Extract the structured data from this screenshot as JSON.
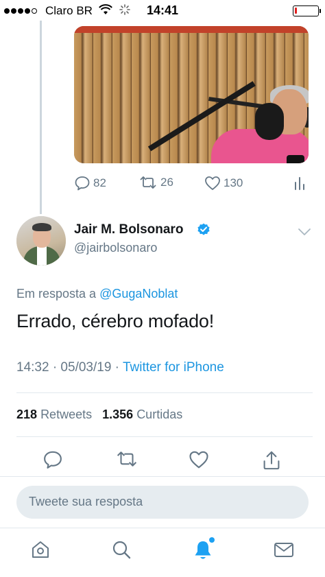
{
  "status_bar": {
    "carrier": "Claro BR",
    "time": "14:41",
    "icons": [
      "signal-dots-icon",
      "wifi-icon",
      "loading-spinner-icon",
      "battery-icon"
    ],
    "battery_color": "#e02020"
  },
  "previous_tweet": {
    "media": "video-thumbnail",
    "replies": "82",
    "retweets": "26",
    "likes": "130"
  },
  "tweet": {
    "display_name": "Jair M. Bolsonaro",
    "handle": "@jairbolsonaro",
    "verified": true,
    "reply_prefix": "Em resposta a",
    "reply_mention": "@GugaNoblat",
    "text": "Errado, cérebro mofado!",
    "timestamp": "14:32 · 05/03/19 ·",
    "source": "Twitter for iPhone",
    "retweets_count": "218",
    "retweets_label": "Retweets",
    "likes_count": "1.356",
    "likes_label": "Curtidas"
  },
  "reply_box": {
    "placeholder": "Tweete sua resposta"
  },
  "tab_bar": {
    "items": [
      "home-icon",
      "search-icon",
      "notifications-icon",
      "messages-icon"
    ],
    "active": "notifications-icon"
  },
  "colors": {
    "accent": "#1da1f2",
    "link": "#1b95e0",
    "muted": "#657786",
    "text": "#14171a",
    "divider": "#e1e8ed"
  }
}
